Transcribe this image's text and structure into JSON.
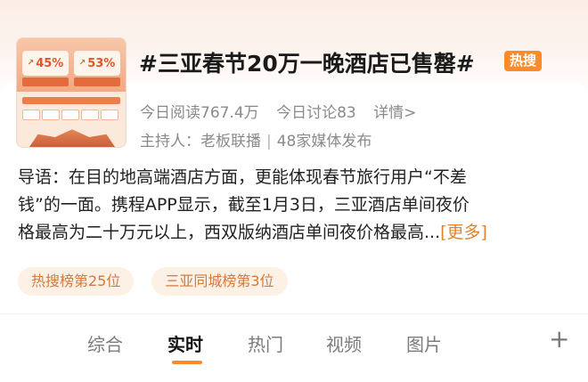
{
  "topic": {
    "title": "#三亚春节20万一晚酒店已售罄#",
    "badge": "热搜",
    "reads_label": "今日阅读767.4万",
    "discussions_label": "今日讨论83",
    "detail_link": "详情>",
    "host_label": "主持人：老板联播",
    "separator": "|",
    "media_label": "48家媒体发布"
  },
  "thumbnail": {
    "stat_left": "45%",
    "stat_right": "53%"
  },
  "guide": {
    "line1": "导语：在目的地高端酒店方面，更能体现春节旅行用户“不差",
    "line2": "钱”的一面。携程APP显示，截至1月3日，三亚酒店单间夜价",
    "line3": "格最高为二十万元以上，西双版纳酒店单间夜价格最高...",
    "more": "[更多]"
  },
  "tags": [
    {
      "label": "热搜榜第25位"
    },
    {
      "label": "三亚同城榜第3位"
    }
  ],
  "tabs": [
    {
      "label": "综合",
      "active": false
    },
    {
      "label": "实时",
      "active": true
    },
    {
      "label": "热门",
      "active": false
    },
    {
      "label": "视频",
      "active": false
    },
    {
      "label": "图片",
      "active": false
    }
  ],
  "add_tab": "+",
  "colors": {
    "accent": "#ff8a2a",
    "tag_bg": "#fdf1e6",
    "tag_text": "#d4783c",
    "more_link": "#e0852e"
  }
}
